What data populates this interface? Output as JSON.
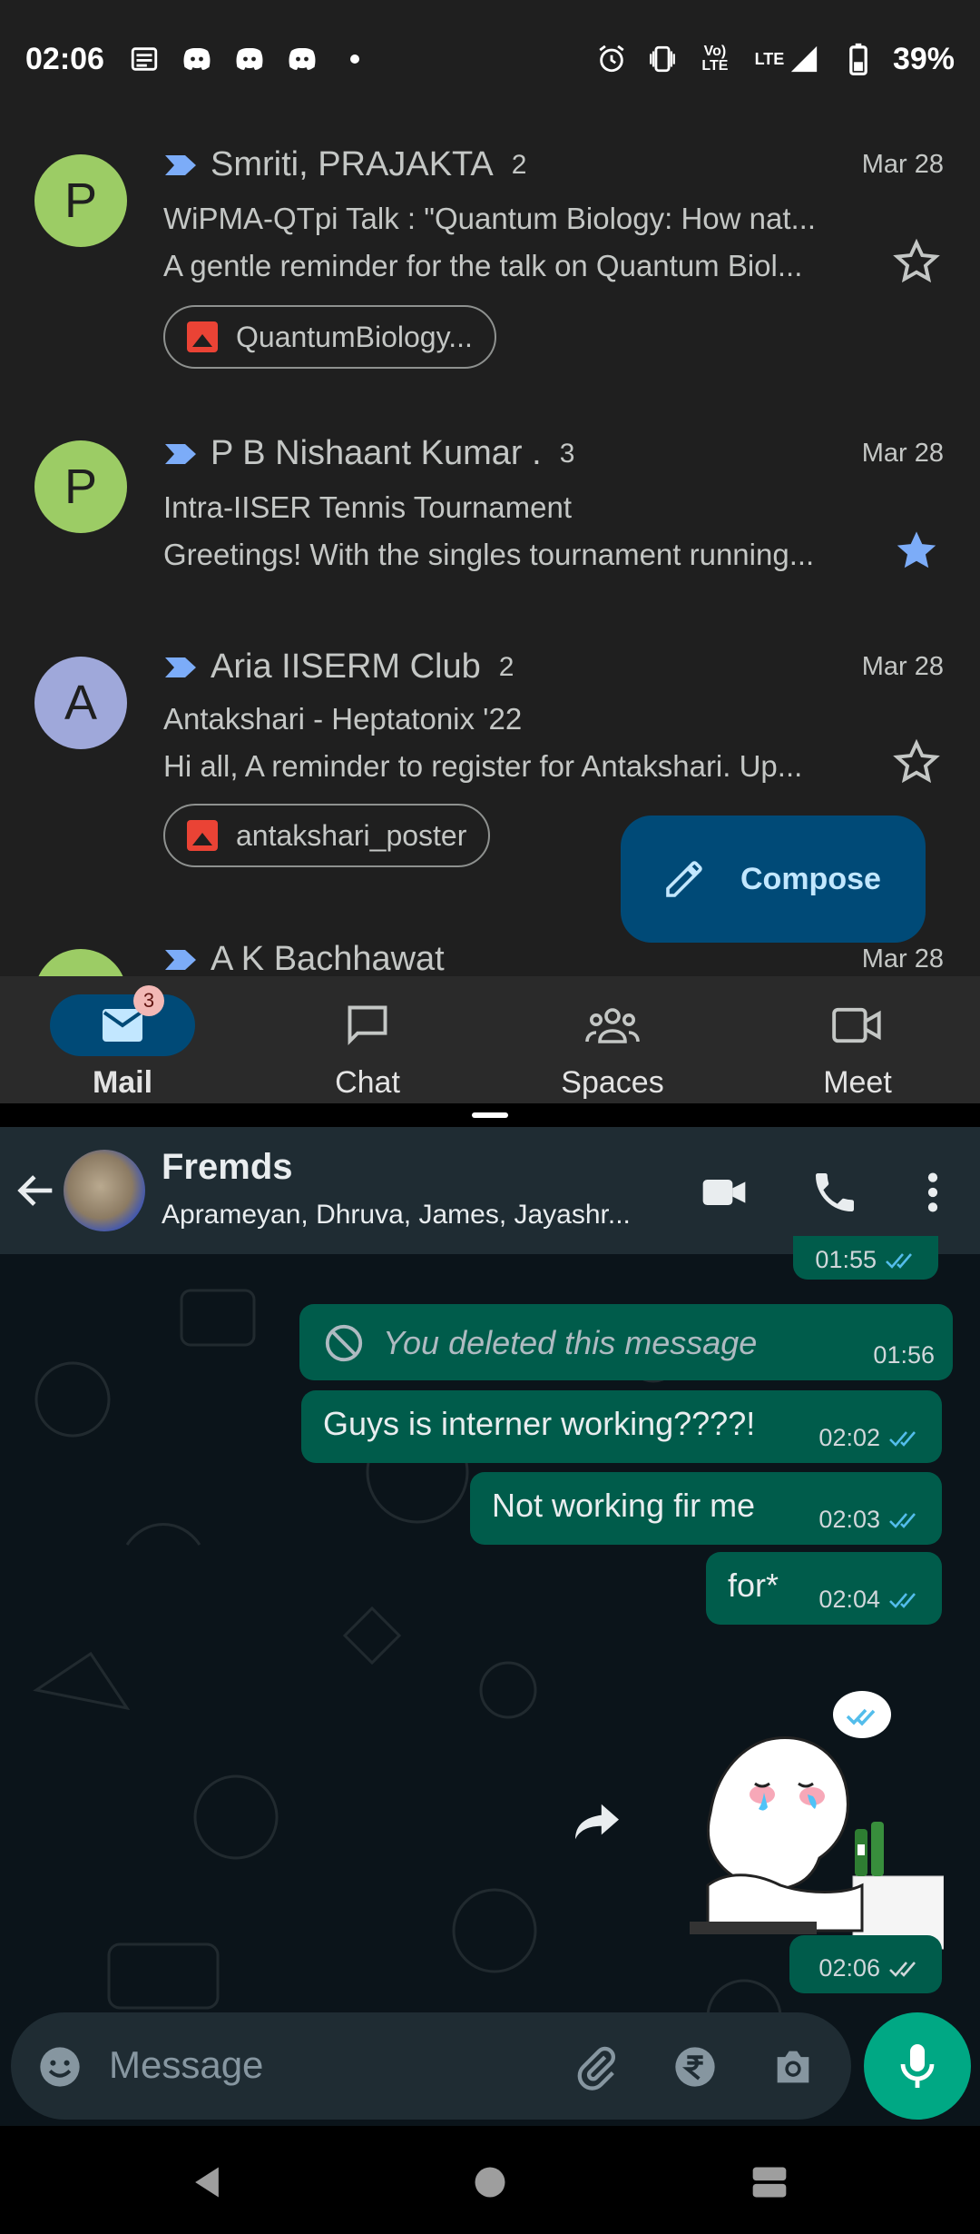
{
  "status_bar": {
    "time": "02:06",
    "battery": "39%",
    "network": "LTE",
    "volte": "Vo) LTE"
  },
  "gmail": {
    "threads": [
      {
        "avatar_letter": "P",
        "sender": "Smriti, PRAJAKTA",
        "count": "2",
        "date": "Mar 28",
        "subject": "WiPMA-QTpi Talk : \"Quantum Biology: How nat...",
        "snippet": "A gentle reminder for the talk on Quantum Biol...",
        "starred": false,
        "attachment": "QuantumBiology..."
      },
      {
        "avatar_letter": "P",
        "sender": "P B Nishaant Kumar .",
        "count": "3",
        "date": "Mar 28",
        "subject": "Intra-IISER Tennis Tournament",
        "snippet": "Greetings! With the singles tournament running...",
        "starred": true
      },
      {
        "avatar_letter": "A",
        "sender": "Aria IISERM Club",
        "count": "2",
        "date": "Mar 28",
        "subject": "Antakshari - Heptatonix '22",
        "snippet": "Hi all, A reminder to register for Antakshari. Up...",
        "starred": false,
        "attachment": "antakshari_poster"
      },
      {
        "sender": "A K Bachhawat",
        "date": "Mar 28"
      }
    ],
    "compose_label": "Compose",
    "nav": {
      "mail": "Mail",
      "mail_badge": "3",
      "chat": "Chat",
      "spaces": "Spaces",
      "meet": "Meet"
    },
    "colors": {
      "accent_star": "#7cacf8",
      "compose_bg": "#004a77"
    }
  },
  "whatsapp": {
    "group_name": "Fremds",
    "members": "Aprameyan, Dhruva, James, Jayashr...",
    "partial_time": "01:55",
    "messages": [
      {
        "text": "You deleted this message",
        "time": "01:56",
        "deleted": true
      },
      {
        "text": "Guys is interner working????!",
        "time": "02:02"
      },
      {
        "text": "Not working fir me",
        "time": "02:03"
      },
      {
        "text": "for*",
        "time": "02:04"
      }
    ],
    "sticker_time": "02:06",
    "input_placeholder": "Message",
    "colors": {
      "outgoing_bubble": "#005c4b",
      "tick_blue": "#53bdeb",
      "mic": "#00a884"
    }
  }
}
